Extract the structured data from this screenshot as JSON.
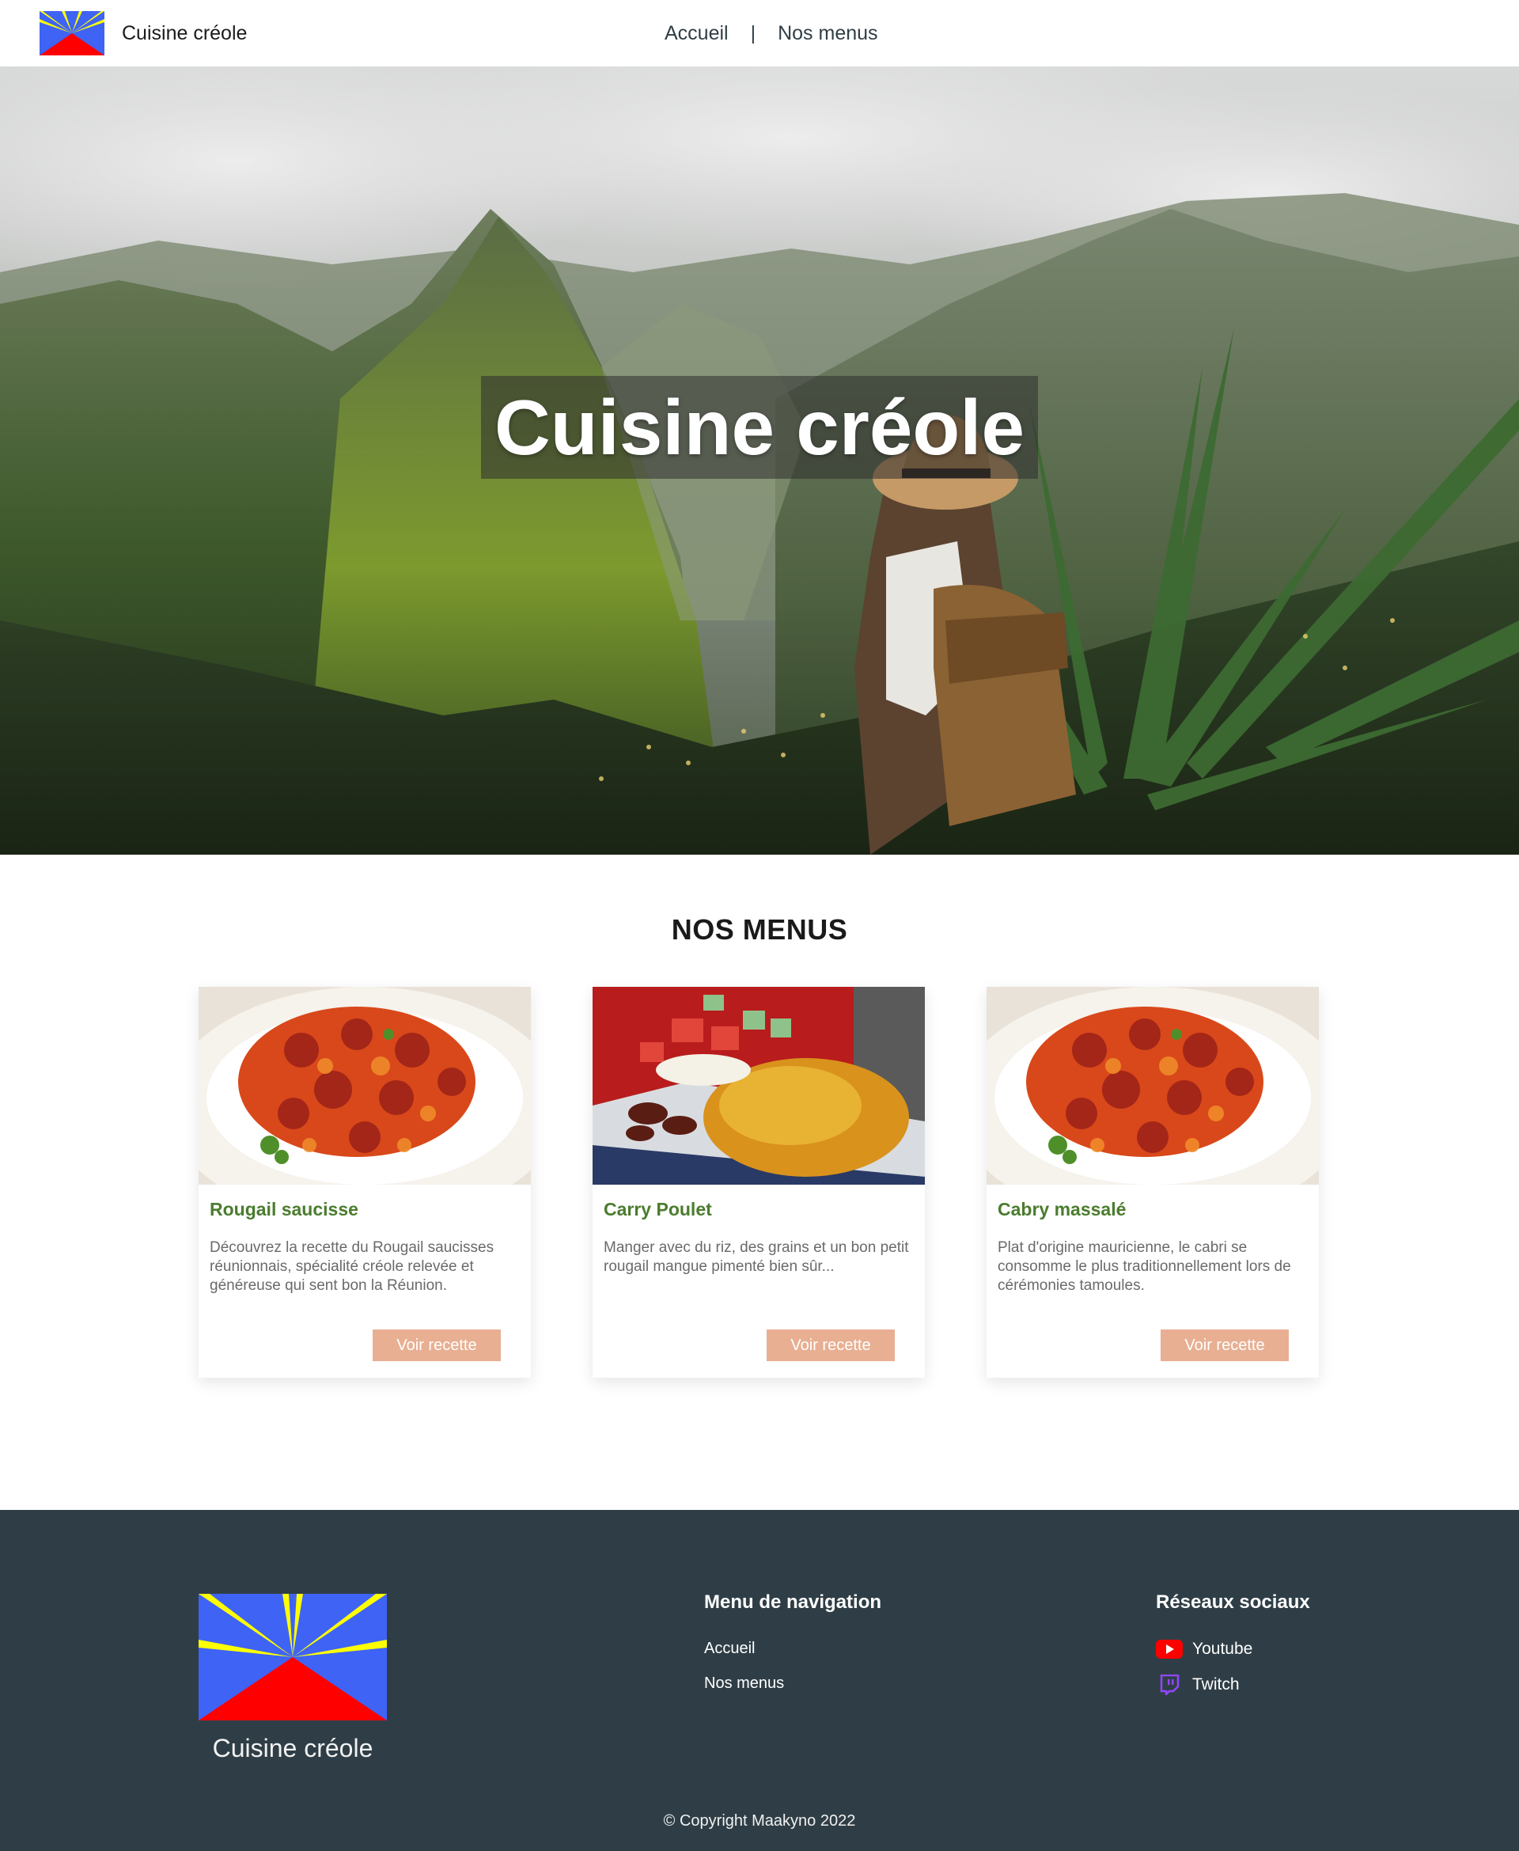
{
  "navbar": {
    "brand_name": "Cuisine créole",
    "links": [
      {
        "label": "Accueil"
      },
      {
        "label": "Nos menus"
      }
    ],
    "separator": "|"
  },
  "hero": {
    "title": "Cuisine créole"
  },
  "menus": {
    "section_title": "NOS MENUS",
    "cards": [
      {
        "title": "Rougail saucisse",
        "description": "Découvrez la recette du Rougail saucisses réunionnais, spécialité créole relevée et généreuse qui sent bon la Réunion.",
        "button_label": "Voir recette"
      },
      {
        "title": "Carry Poulet",
        "description": "Manger avec du riz, des grains et un bon petit rougail mangue pimenté bien sûr...",
        "button_label": "Voir recette"
      },
      {
        "title": "Cabry massalé",
        "description": "Plat d'origine mauricienne, le cabri se consomme le plus traditionnellement lors de cérémonies tamoules.",
        "button_label": "Voir recette"
      }
    ]
  },
  "footer": {
    "brand_name": "Cuisine créole",
    "nav_heading": "Menu de navigation",
    "nav_links": [
      {
        "label": "Accueil"
      },
      {
        "label": "Nos menus"
      }
    ],
    "social_heading": "Réseaux sociaux",
    "social_links": [
      {
        "label": "Youtube",
        "icon": "youtube-icon"
      },
      {
        "label": "Twitch",
        "icon": "twitch-icon"
      }
    ],
    "copyright": "© Copyright Maakyno 2022"
  },
  "colors": {
    "nav_text": "#2f3e46",
    "card_title": "#4a7c2e",
    "button_bg": "#e8af92",
    "footer_bg": "#2f3e46",
    "flag_blue": "#3f63f5",
    "flag_red": "#ff0000",
    "flag_yellow": "#ffff00"
  }
}
